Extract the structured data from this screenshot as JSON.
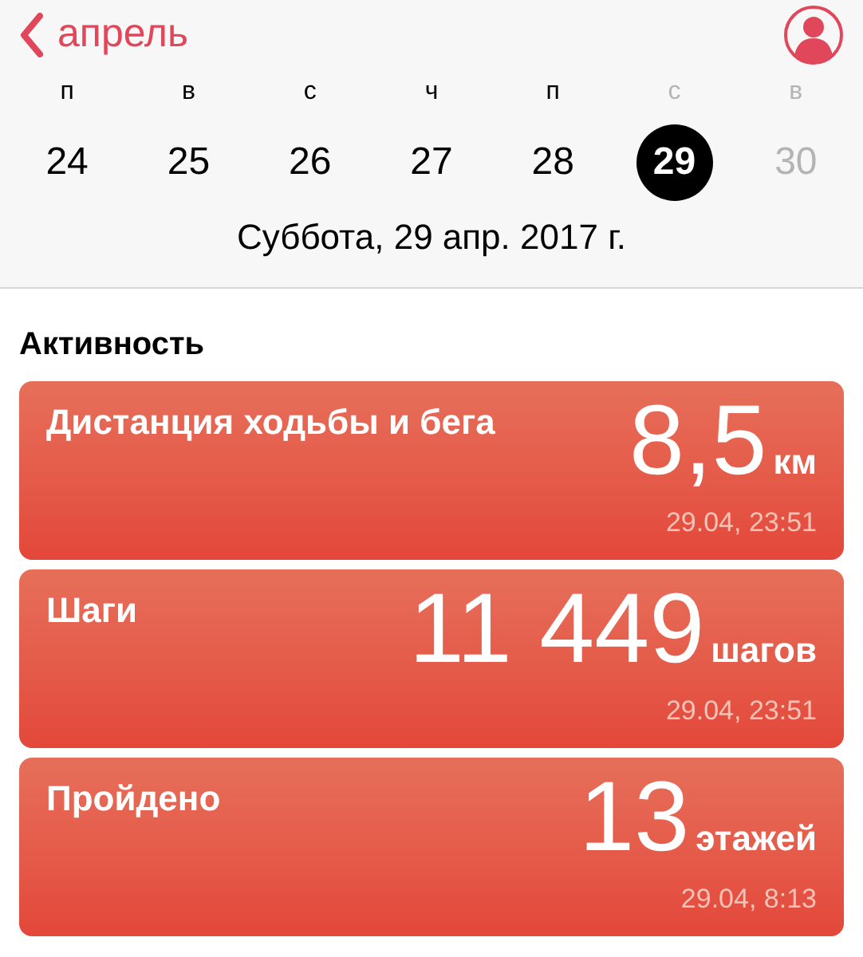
{
  "nav": {
    "back": "апрель"
  },
  "week": [
    {
      "weekday": "п",
      "day": "24",
      "weekday_dimmed": false,
      "disabled": false,
      "selected": false
    },
    {
      "weekday": "в",
      "day": "25",
      "weekday_dimmed": false,
      "disabled": false,
      "selected": false
    },
    {
      "weekday": "с",
      "day": "26",
      "weekday_dimmed": false,
      "disabled": false,
      "selected": false
    },
    {
      "weekday": "ч",
      "day": "27",
      "weekday_dimmed": false,
      "disabled": false,
      "selected": false
    },
    {
      "weekday": "п",
      "day": "28",
      "weekday_dimmed": false,
      "disabled": false,
      "selected": false
    },
    {
      "weekday": "с",
      "day": "29",
      "weekday_dimmed": true,
      "disabled": false,
      "selected": true
    },
    {
      "weekday": "в",
      "day": "30",
      "weekday_dimmed": true,
      "disabled": true,
      "selected": false
    }
  ],
  "date": "Суббота, 29 апр. 2017 г.",
  "section": "Активность",
  "cards": [
    {
      "title": "Дистанция ходьбы и бега",
      "value": "8,5",
      "unit": "км",
      "time": "29.04, 23:51"
    },
    {
      "title": "Шаги",
      "value": "11 449",
      "unit": "шагов",
      "time": "29.04, 23:51"
    },
    {
      "title": "Пройдено",
      "value": "13",
      "unit": "этажей",
      "time": "29.04, 8:13"
    }
  ]
}
